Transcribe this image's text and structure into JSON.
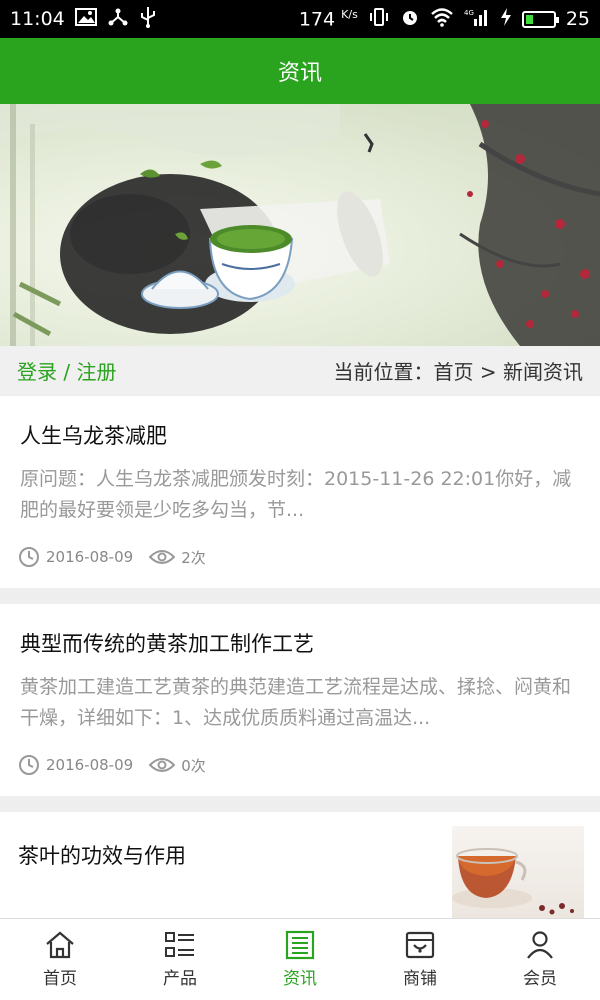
{
  "status_bar": {
    "time": "11:04",
    "net_speed": "174",
    "net_unit": "K/s",
    "battery": "25",
    "network_type": "4G",
    "battery_level": 0.25
  },
  "header": {
    "title": "资讯"
  },
  "location_bar": {
    "login_text": "登录 / 注册",
    "current_position": "当前位置：首页 > 新闻资讯"
  },
  "news": [
    {
      "title": "人生乌龙茶减肥",
      "summary": "原问题：人生乌龙茶减肥颁发时刻：2015-11-26 22:01你好，减肥的最好要领是少吃多勾当，节...",
      "date": "2016-08-09",
      "views": "2次"
    },
    {
      "title": "典型而传统的黄茶加工制作工艺",
      "summary": "黄茶加工建造工艺黄茶的典范建造工艺流程是达成、揉捻、闷黄和干燥，详细如下：1、达成优质质料通过高温达...",
      "date": "2016-08-09",
      "views": "0次"
    },
    {
      "title": "茶叶的功效与作用"
    }
  ],
  "tabbar": {
    "items": [
      {
        "label": "首页",
        "icon": "home-icon"
      },
      {
        "label": "产品",
        "icon": "list-icon"
      },
      {
        "label": "资讯",
        "icon": "news-icon",
        "active": true
      },
      {
        "label": "商铺",
        "icon": "shop-icon"
      },
      {
        "label": "会员",
        "icon": "user-icon"
      }
    ]
  },
  "colors": {
    "brand_green": "#2aa31f",
    "summary_gray": "#999999"
  }
}
